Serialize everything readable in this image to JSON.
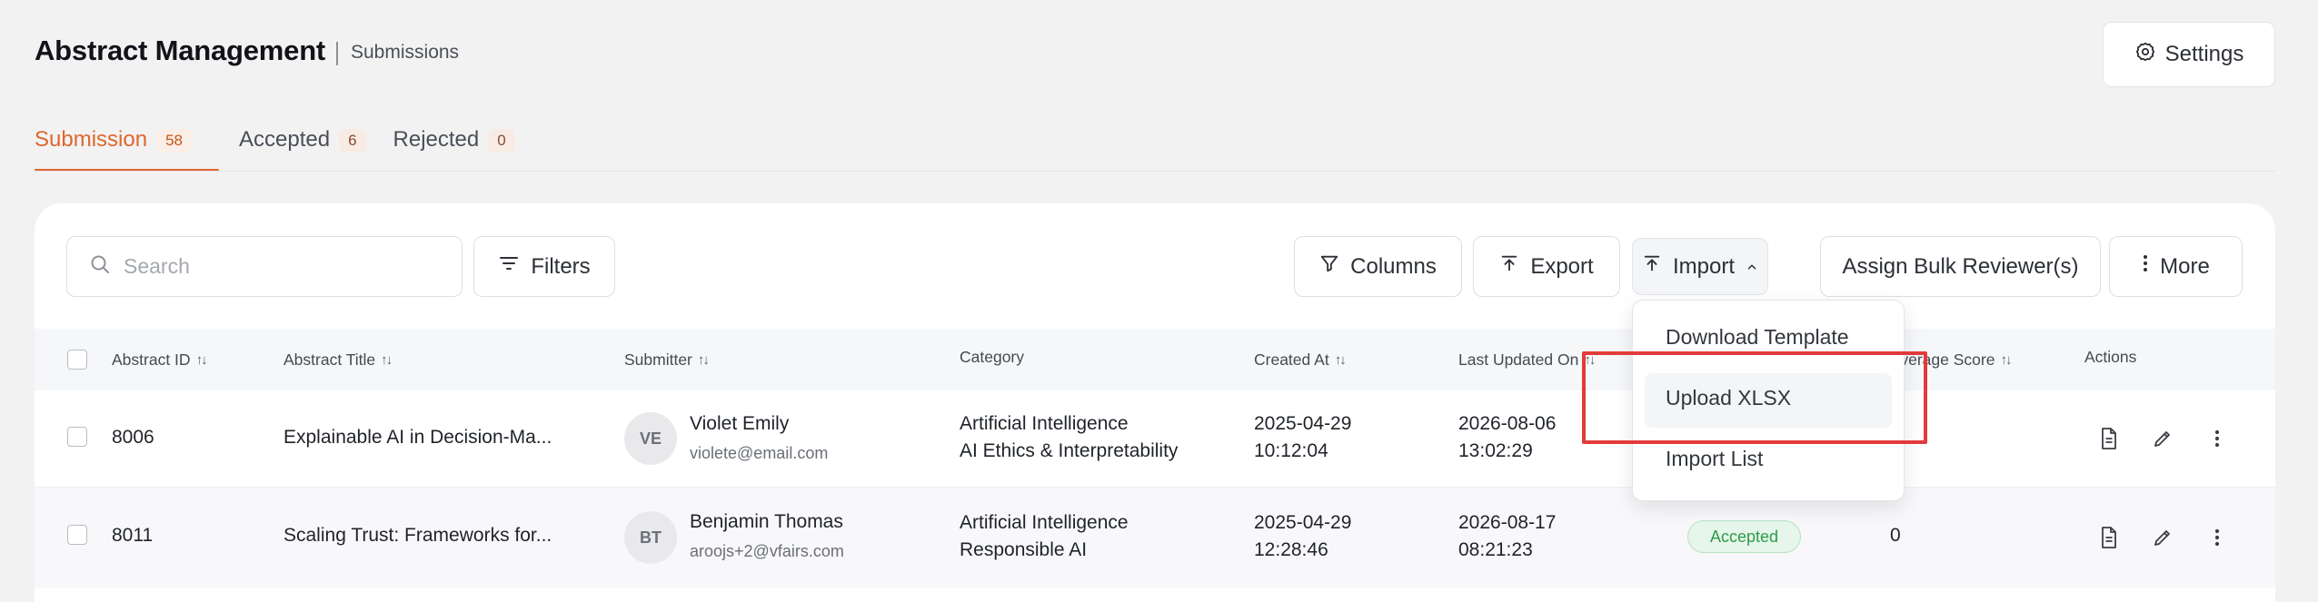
{
  "header": {
    "title": "Abstract Management",
    "subtitle": "Submissions",
    "settings_label": "Settings"
  },
  "tabs": [
    {
      "label": "Submission",
      "count": "58"
    },
    {
      "label": "Accepted",
      "count": "6"
    },
    {
      "label": "Rejected",
      "count": "0"
    }
  ],
  "toolbar": {
    "search_placeholder": "Search",
    "filters_label": "Filters",
    "columns_label": "Columns",
    "export_label": "Export",
    "import_label": "Import",
    "bulk_reviewer_label": "Assign Bulk Reviewer(s)",
    "more_label": "More"
  },
  "import_menu": {
    "items": [
      "Download Template",
      "Upload XLSX",
      "Import List"
    ]
  },
  "table": {
    "columns": {
      "abstract_id": "Abstract ID",
      "abstract_title": "Abstract Title",
      "submitter": "Submitter",
      "category": "Category",
      "created_at": "Created At",
      "last_updated_on": "Last Updated On",
      "average_score": "Average Score",
      "actions": "Actions"
    },
    "rows": [
      {
        "id": "8006",
        "title": "Explainable AI in Decision-Ma...",
        "initials": "VE",
        "name": "Violet Emily",
        "email": "violete@email.com",
        "category_1": "Artificial Intelligence",
        "category_2": "AI Ethics & Interpretability",
        "created_date": "2025-04-29",
        "created_time": "10:12:04",
        "updated_date": "2026-08-06",
        "updated_time": "13:02:29",
        "status": "",
        "score": "0"
      },
      {
        "id": "8011",
        "title": "Scaling Trust: Frameworks for...",
        "initials": "BT",
        "name": "Benjamin Thomas",
        "email": "aroojs+2@vfairs.com",
        "category_1": "Artificial Intelligence",
        "category_2": "Responsible AI",
        "created_date": "2025-04-29",
        "created_time": "12:28:46",
        "updated_date": "2026-08-17",
        "updated_time": "08:21:23",
        "status": "Accepted",
        "score": "0"
      }
    ]
  },
  "colors": {
    "accent": "#e0662b",
    "highlight": "#e23b3b",
    "accepted": "#2d9a4b"
  }
}
